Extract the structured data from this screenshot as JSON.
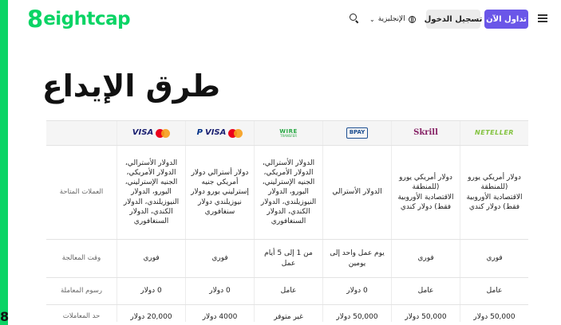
{
  "header": {
    "logo_mark": "8",
    "logo_text": "eightcap",
    "trade_button": "تداول الآن",
    "login_button": "تسجيل الدخول",
    "language": "الإنجليزية"
  },
  "page": {
    "title": "طرق الإيداع"
  },
  "table": {
    "row_labels": {
      "currencies": "العملات المتاحة",
      "processing_time": "وقت المعالجة",
      "fees": "رسوم المعاملة",
      "limits": "حد المعاملات"
    },
    "columns": [
      {
        "method": "NETELLER",
        "currencies": "دولار أمريكي يورو (للمنطقة الاقتصادية الأوروبية فقط) دولار كندي",
        "processing_time": "فوري",
        "fee": "عامل",
        "limit": "50,000 دولار"
      },
      {
        "method": "Skrill",
        "currencies": "دولار أمريكي يورو (للمنطقة الاقتصادية الأوروبية فقط) دولار كندي",
        "processing_time": "فوري",
        "fee": "عامل",
        "limit": "50,000 دولار"
      },
      {
        "method": "BPAY",
        "currencies": "الدولار الأسترالي",
        "processing_time": "يوم عمل واحد إلى يومين",
        "fee": "0 دولار",
        "limit": "50,000 دولار"
      },
      {
        "method": "WIRE TRANSFER",
        "currencies": "الدولار الأسترالي، الدولار الأمريكي، الجنيه الإسترليني، اليورو، الدولار النيوزيلندي، الدولار الكندي، الدولار السنغافوري",
        "processing_time": "من 1 إلى 5 أيام عمل",
        "fee": "عامل",
        "limit": "غير متوفر"
      },
      {
        "method": "VISA PayPal Mastercard",
        "currencies": "دولار أسترالي دولار أمريكي جنيه إسترليني يورو دولار نيوزيلندي دولار سنغافوري",
        "processing_time": "فوري",
        "fee": "0 دولار",
        "limit": "4000 دولار"
      },
      {
        "method": "VISA Mastercard",
        "currencies": "الدولار الأسترالي، الدولار الأمريكي، الجنيه الإسترليني، اليورو، الدولار النيوزيلندي، الدولار الكندي، الدولار السنغافوري",
        "processing_time": "فوري",
        "fee": "0 دولار",
        "limit": "20,000 دولار"
      }
    ]
  },
  "side_fragment": "8",
  "colors": {
    "brand_green": "#0bd465",
    "trade_purple": "#6a56e8"
  }
}
